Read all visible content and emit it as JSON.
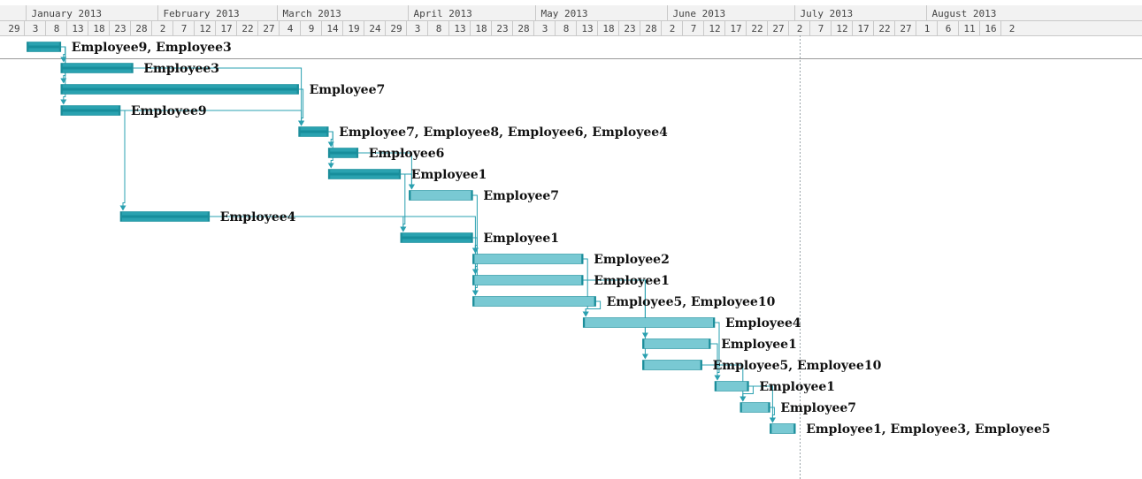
{
  "chart_data": {
    "type": "gantt",
    "timeline": {
      "start": "2012-12-29",
      "end": "2013-08-22",
      "month_headers": [
        "January 2013",
        "February 2013",
        "March 2013",
        "April 2013",
        "May 2013",
        "June 2013",
        "July 2013",
        "August 2013"
      ],
      "month_starts": [
        "2013-01-01",
        "2013-02-01",
        "2013-03-01",
        "2013-04-01",
        "2013-05-01",
        "2013-06-01",
        "2013-07-01",
        "2013-08-01"
      ],
      "day_ticks": [
        "2012-12-29",
        "2013-01-03",
        "2013-01-08",
        "2013-01-13",
        "2013-01-18",
        "2013-01-23",
        "2013-01-28",
        "2013-02-02",
        "2013-02-07",
        "2013-02-12",
        "2013-02-17",
        "2013-02-22",
        "2013-02-27",
        "2013-03-04",
        "2013-03-09",
        "2013-03-14",
        "2013-03-19",
        "2013-03-24",
        "2013-03-29",
        "2013-04-03",
        "2013-04-08",
        "2013-04-13",
        "2013-04-18",
        "2013-04-23",
        "2013-04-28",
        "2013-05-03",
        "2013-05-08",
        "2013-05-13",
        "2013-05-18",
        "2013-05-23",
        "2013-05-28",
        "2013-06-02",
        "2013-06-07",
        "2013-06-12",
        "2013-06-17",
        "2013-06-22",
        "2013-06-27",
        "2013-07-02",
        "2013-07-07",
        "2013-07-12",
        "2013-07-17",
        "2013-07-22",
        "2013-07-27",
        "2013-08-01",
        "2013-08-06",
        "2013-08-11",
        "2013-08-16",
        "2013-08-21"
      ],
      "day_tick_labels": [
        "29",
        "3",
        "8",
        "13",
        "18",
        "23",
        "28",
        "2",
        "7",
        "12",
        "17",
        "22",
        "27",
        "4",
        "9",
        "14",
        "19",
        "24",
        "29",
        "3",
        "8",
        "13",
        "18",
        "23",
        "28",
        "3",
        "8",
        "13",
        "18",
        "23",
        "28",
        "2",
        "7",
        "12",
        "17",
        "22",
        "27",
        "2",
        "7",
        "12",
        "17",
        "22",
        "27",
        "1",
        "6",
        "11",
        "16",
        "2"
      ],
      "today": "2013-07-02"
    },
    "tasks": [
      {
        "label": "Employee9, Employee3",
        "start": "2013-01-01",
        "end": "2013-01-09",
        "progress": 1.0
      },
      {
        "label": "Employee3",
        "start": "2013-01-09",
        "end": "2013-01-26",
        "progress": 1.0
      },
      {
        "label": "Employee7",
        "start": "2013-01-09",
        "end": "2013-03-06",
        "progress": 1.0
      },
      {
        "label": "Employee9",
        "start": "2013-01-09",
        "end": "2013-01-23",
        "progress": 1.0
      },
      {
        "label": "Employee7, Employee8, Employee6, Employee4",
        "start": "2013-03-06",
        "end": "2013-03-13",
        "progress": 1.0
      },
      {
        "label": "Employee6",
        "start": "2013-03-13",
        "end": "2013-03-20",
        "progress": 1.0
      },
      {
        "label": "Employee1",
        "start": "2013-03-13",
        "end": "2013-03-30",
        "progress": 1.0
      },
      {
        "label": "Employee7",
        "start": "2013-04-01",
        "end": "2013-04-16",
        "progress": 0.0
      },
      {
        "label": "Employee4",
        "start": "2013-01-23",
        "end": "2013-02-13",
        "progress": 1.0
      },
      {
        "label": "Employee1",
        "start": "2013-03-30",
        "end": "2013-04-16",
        "progress": 1.0
      },
      {
        "label": "Employee2",
        "start": "2013-04-16",
        "end": "2013-05-12",
        "progress": 0.0
      },
      {
        "label": "Employee1",
        "start": "2013-04-16",
        "end": "2013-05-12",
        "progress": 0.0
      },
      {
        "label": "Employee5, Employee10",
        "start": "2013-04-16",
        "end": "2013-05-15",
        "progress": 0.0
      },
      {
        "label": "Employee4",
        "start": "2013-05-12",
        "end": "2013-06-12",
        "progress": 0.0
      },
      {
        "label": "Employee1",
        "start": "2013-05-26",
        "end": "2013-06-11",
        "progress": 0.0
      },
      {
        "label": "Employee5, Employee10",
        "start": "2013-05-26",
        "end": "2013-06-09",
        "progress": 0.0
      },
      {
        "label": "Employee1",
        "start": "2013-06-12",
        "end": "2013-06-20",
        "progress": 0.0
      },
      {
        "label": "Employee7",
        "start": "2013-06-18",
        "end": "2013-06-25",
        "progress": 0.0
      },
      {
        "label": "Employee1, Employee3, Employee5",
        "start": "2013-06-25",
        "end": "2013-07-01",
        "progress": 0.0
      }
    ],
    "dependencies": [
      [
        0,
        1
      ],
      [
        0,
        2
      ],
      [
        0,
        3
      ],
      [
        1,
        4
      ],
      [
        2,
        4
      ],
      [
        3,
        4
      ],
      [
        3,
        8
      ],
      [
        4,
        5
      ],
      [
        4,
        6
      ],
      [
        5,
        7
      ],
      [
        6,
        7
      ],
      [
        6,
        9
      ],
      [
        8,
        9
      ],
      [
        7,
        10
      ],
      [
        9,
        10
      ],
      [
        9,
        11
      ],
      [
        9,
        12
      ],
      [
        8,
        12
      ],
      [
        10,
        13
      ],
      [
        12,
        13
      ],
      [
        11,
        14
      ],
      [
        11,
        15
      ],
      [
        13,
        16
      ],
      [
        14,
        16
      ],
      [
        15,
        17
      ],
      [
        16,
        17
      ],
      [
        16,
        18
      ],
      [
        17,
        18
      ]
    ],
    "colors": {
      "bar_fill": "#79c9d3",
      "bar_done": "#2aa2b0",
      "bar_done_core": "#178e9c",
      "bar_edge": "#1c8e9b",
      "link": "#2aa0b0",
      "header_bg": "#f2f2f2",
      "grid_line": "#c9c9c9",
      "today_line": "#9aa4a8",
      "label_text": "#111111",
      "header_text": "#444444"
    }
  }
}
